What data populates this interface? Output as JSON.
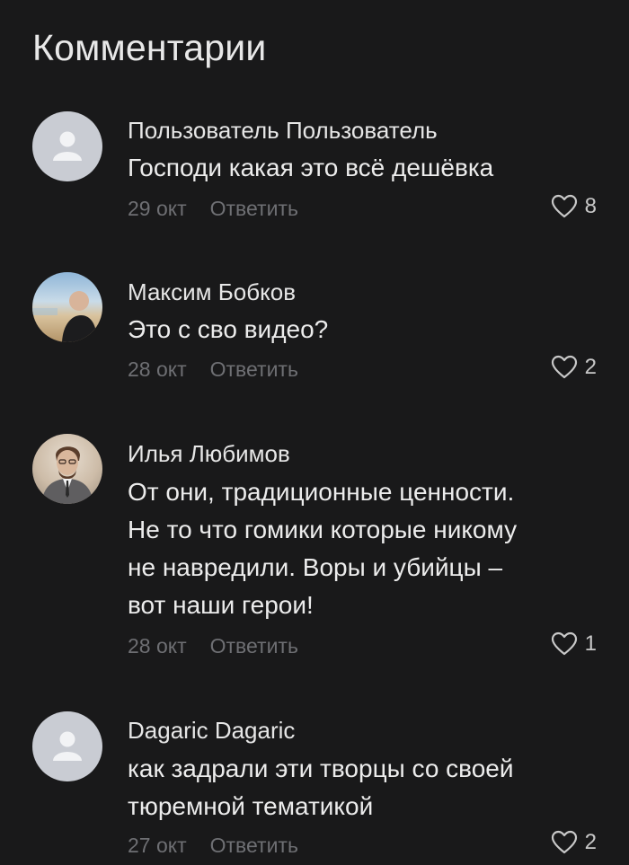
{
  "header": {
    "title": "Комментарии"
  },
  "comments": [
    {
      "author": "Пользователь Пользователь",
      "lines": [
        "Господи какая это всё дешёвка"
      ],
      "date": "29 окт",
      "reply": "Ответить",
      "likes": "8",
      "avatar": "default-user-icon"
    },
    {
      "author": "Максим Бобков",
      "lines": [
        "Это с сво видео?"
      ],
      "date": "28 окт",
      "reply": "Ответить",
      "likes": "2",
      "avatar": "photo"
    },
    {
      "author": "Илья Любимов",
      "lines": [
        "От они, традиционные ценности.",
        "Не то что гомики которые никому",
        "не навредили. Воры и убийцы –",
        "вот наши герои!"
      ],
      "date": "28 окт",
      "reply": "Ответить",
      "likes": "1",
      "avatar": "photo"
    },
    {
      "author": "Dagaric Dagaric",
      "lines": [
        "как задрали эти творцы со своей",
        "тюремной тематикой"
      ],
      "date": "27 окт",
      "reply": "Ответить",
      "likes": "2",
      "avatar": "default-user-icon"
    }
  ],
  "colors": {
    "background": "#19191a",
    "meta": "#6e6f73",
    "text": "#ececec"
  }
}
